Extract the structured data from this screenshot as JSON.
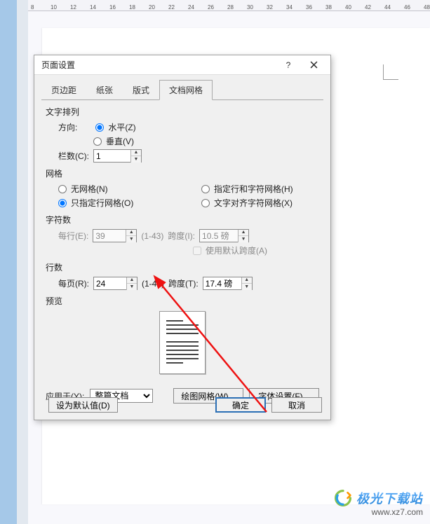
{
  "ruler": {
    "start": 8,
    "end": 48
  },
  "dialog": {
    "title": "页面设置",
    "help_glyph": "?",
    "tabs": [
      "页边距",
      "纸张",
      "版式",
      "文档网格"
    ],
    "active_tab_index": 3,
    "text_orient": {
      "group": "文字排列",
      "direction_label": "方向:",
      "horizontal": "水平(Z)",
      "vertical": "垂直(V)",
      "columns_label": "栏数(C):",
      "columns_value": "1"
    },
    "grid": {
      "group": "网格",
      "none": "无网格(N)",
      "row_only": "只指定行网格(O)",
      "row_char": "指定行和字符网格(H)",
      "snap_char": "文字对齐字符网格(X)"
    },
    "chars": {
      "group": "字符数",
      "per_line_label": "每行(E):",
      "per_line_value": "39",
      "per_line_range": "(1-43)",
      "span_label": "跨度(I):",
      "span_value": "10.5 磅",
      "default_span": "使用默认跨度(A)"
    },
    "lines": {
      "group": "行数",
      "per_page_label": "每页(R):",
      "per_page_value": "24",
      "per_page_range": "(1-48)",
      "span_label": "跨度(T):",
      "span_value": "17.4 磅"
    },
    "preview": {
      "group": "预览"
    },
    "apply": {
      "label": "应用于(Y):",
      "value": "整篇文档",
      "draw_grid": "绘图网格(W)...",
      "font_settings": "字体设置(F)..."
    },
    "footer": {
      "set_default": "设为默认值(D)",
      "ok": "确定",
      "cancel": "取消"
    }
  },
  "watermark": {
    "brand": "极光下载站",
    "url": "www.xz7.com"
  }
}
